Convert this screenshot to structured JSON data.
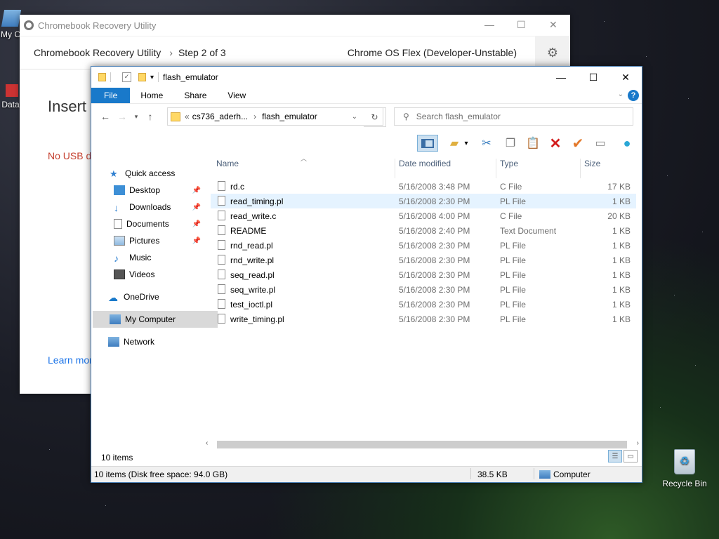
{
  "desktop": {
    "icon_my_computer": "My C",
    "icon_data": "Data",
    "recycle_bin": "Recycle Bin"
  },
  "recovery": {
    "title": "Chromebook Recovery Utility",
    "app_name": "Chromebook Recovery Utility",
    "step": "Step 2 of 3",
    "os_name": "Chrome OS Flex (Developer-Unstable)",
    "insert_heading": "Insert",
    "no_usb": "No USB dr",
    "learn_more": "Learn more"
  },
  "explorer": {
    "title": "flash_emulator",
    "ribbon_tabs": [
      "File",
      "Home",
      "Share",
      "View"
    ],
    "breadcrumb_prefix": "«",
    "breadcrumb_parent": "cs736_aderh...",
    "breadcrumb_current": "flash_emulator",
    "search_placeholder": "Search flash_emulator",
    "columns": {
      "name": "Name",
      "date": "Date modified",
      "type": "Type",
      "size": "Size"
    },
    "nav": {
      "quick_access": "Quick access",
      "desktop": "Desktop",
      "downloads": "Downloads",
      "documents": "Documents",
      "pictures": "Pictures",
      "music": "Music",
      "videos": "Videos",
      "onedrive": "OneDrive",
      "my_computer": "My Computer",
      "network": "Network"
    },
    "files": [
      {
        "name": "rd.c",
        "date": "5/16/2008 3:48 PM",
        "type": "C File",
        "size": "17 KB"
      },
      {
        "name": "read_timing.pl",
        "date": "5/16/2008 2:30 PM",
        "type": "PL File",
        "size": "1 KB"
      },
      {
        "name": "read_write.c",
        "date": "5/16/2008 4:00 PM",
        "type": "C File",
        "size": "20 KB"
      },
      {
        "name": "README",
        "date": "5/16/2008 2:40 PM",
        "type": "Text Document",
        "size": "1 KB"
      },
      {
        "name": "rnd_read.pl",
        "date": "5/16/2008 2:30 PM",
        "type": "PL File",
        "size": "1 KB"
      },
      {
        "name": "rnd_write.pl",
        "date": "5/16/2008 2:30 PM",
        "type": "PL File",
        "size": "1 KB"
      },
      {
        "name": "seq_read.pl",
        "date": "5/16/2008 2:30 PM",
        "type": "PL File",
        "size": "1 KB"
      },
      {
        "name": "seq_write.pl",
        "date": "5/16/2008 2:30 PM",
        "type": "PL File",
        "size": "1 KB"
      },
      {
        "name": "test_ioctl.pl",
        "date": "5/16/2008 2:30 PM",
        "type": "PL File",
        "size": "1 KB"
      },
      {
        "name": "write_timing.pl",
        "date": "5/16/2008 2:30 PM",
        "type": "PL File",
        "size": "1 KB"
      }
    ],
    "item_count": "10 items",
    "status_left": "10 items (Disk free space: 94.0 GB)",
    "status_size": "38.5 KB",
    "status_location": "Computer"
  },
  "colors": {
    "accent": "#1979ca",
    "hover_row": "#e5f3ff",
    "selected_nav": "#cce0f0",
    "error": "#c5402f"
  }
}
